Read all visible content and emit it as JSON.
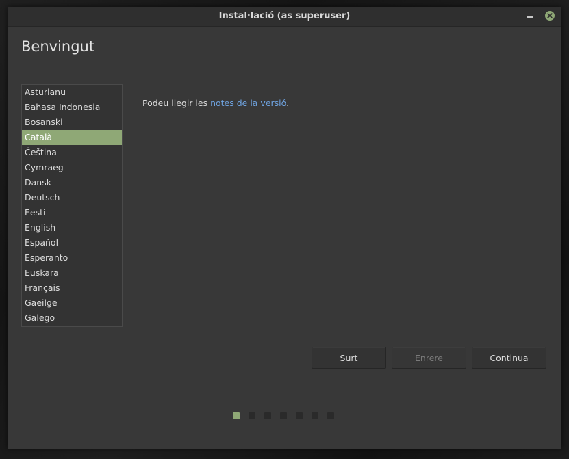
{
  "window": {
    "title": "Instal·lació (as superuser)"
  },
  "page": {
    "heading": "Benvingut",
    "notes_prefix": "Podeu llegir les ",
    "notes_link": "notes de la versió",
    "notes_suffix": "."
  },
  "languages": {
    "items": [
      "Asturianu",
      "Bahasa Indonesia",
      "Bosanski",
      "Català",
      "Čeština",
      "Cymraeg",
      "Dansk",
      "Deutsch",
      "Eesti",
      "English",
      "Español",
      "Esperanto",
      "Euskara",
      "Français",
      "Gaeilge",
      "Galego"
    ],
    "selected": "Català"
  },
  "buttons": {
    "quit": "Surt",
    "back": "Enrere",
    "continue": "Continua"
  },
  "progress": {
    "total_steps": 7,
    "current_step": 1
  },
  "colors": {
    "accent": "#8fa876",
    "link": "#6fa3e0",
    "window_bg": "#383838",
    "titlebar_bg": "#2f2f2f"
  },
  "icons": {
    "minimize": "minimize-icon",
    "close": "close-icon"
  }
}
